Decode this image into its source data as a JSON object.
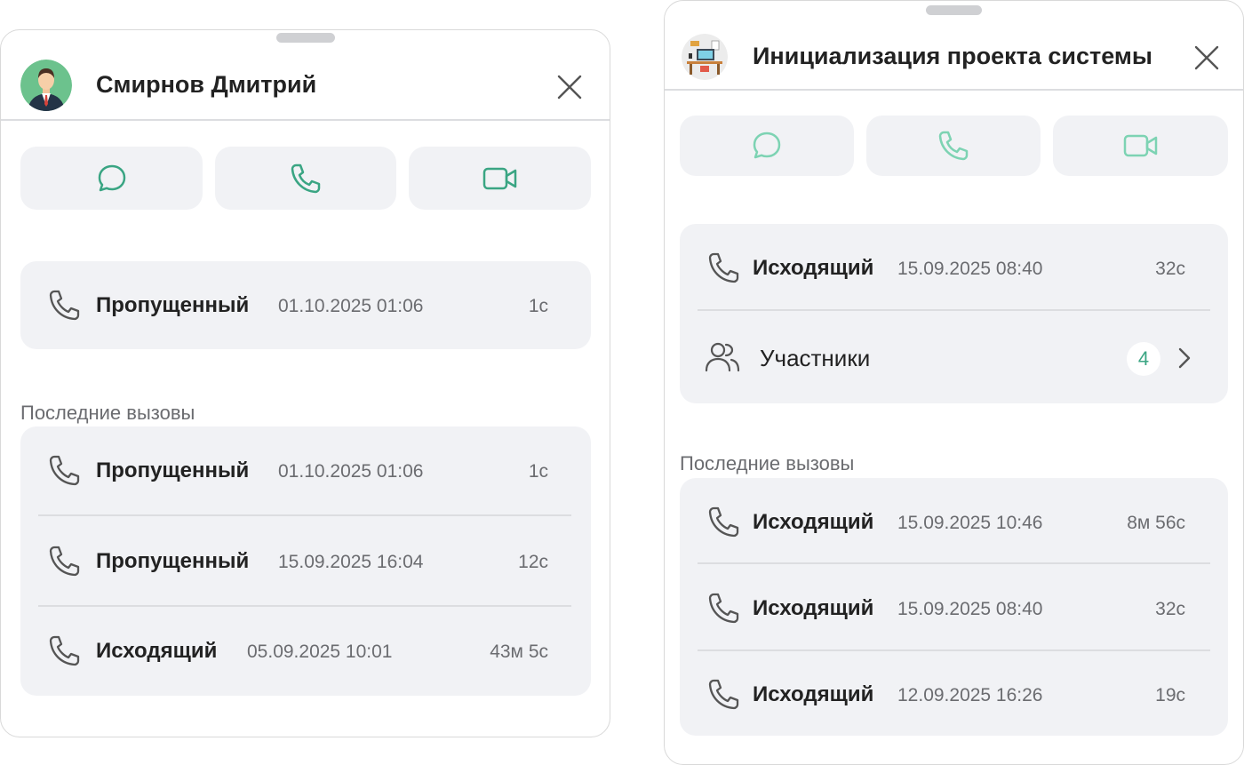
{
  "colors": {
    "accent": "#3aa583",
    "accent_light": "#7dd3b3",
    "card_bg": "#f1f2f5",
    "muted_text": "#6b6c70"
  },
  "left_panel": {
    "contact_name": "Смирнов Дмитрий",
    "avatar_icon": "businessman-avatar",
    "actions": [
      "chat-icon",
      "phone-icon",
      "video-camera-icon"
    ],
    "current_call": {
      "type": "Пропущенный",
      "datetime": "01.10.2025 01:06",
      "duration": "1с"
    },
    "recent_calls_label": "Последние вызовы",
    "recent_calls": [
      {
        "type": "Пропущенный",
        "datetime": "01.10.2025 01:06",
        "duration": "1с"
      },
      {
        "type": "Пропущенный",
        "datetime": "15.09.2025 16:04",
        "duration": "12с"
      },
      {
        "type": "Исходящий",
        "datetime": "05.09.2025 10:01",
        "duration": "43м 5с"
      }
    ]
  },
  "right_panel": {
    "group_title": "Инициализация проекта системы",
    "avatar_icon": "workspace-desk-avatar",
    "actions": [
      "chat-icon",
      "phone-icon",
      "video-camera-icon"
    ],
    "current_call": {
      "type": "Исходящий",
      "datetime": "15.09.2025 08:40",
      "duration": "32с"
    },
    "participants": {
      "label": "Участники",
      "count": "4"
    },
    "recent_calls_label": "Последние вызовы",
    "recent_calls": [
      {
        "type": "Исходящий",
        "datetime": "15.09.2025 10:46",
        "duration": "8м 56с"
      },
      {
        "type": "Исходящий",
        "datetime": "15.09.2025 08:40",
        "duration": "32с"
      },
      {
        "type": "Исходящий",
        "datetime": "12.09.2025 16:26",
        "duration": "19с"
      }
    ]
  }
}
